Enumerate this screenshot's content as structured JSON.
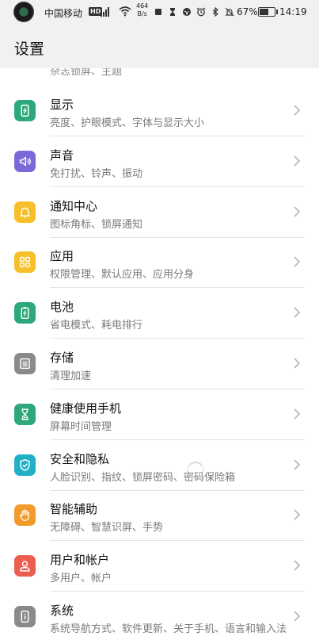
{
  "status_bar": {
    "carrier": "中国移动",
    "hd": "HD",
    "network": "4G",
    "speed_value": "464",
    "speed_unit": "B/s",
    "battery_percent": "67%",
    "battery_level": 0.67,
    "time": "14:19"
  },
  "header": {
    "title": "设置"
  },
  "partial_item": {
    "subtitle": "杂志锁屏、主题",
    "color": "#2ca87a"
  },
  "items": [
    {
      "title": "显示",
      "subtitle": "亮度、护眼模式、字体与显示大小",
      "icon": "display-icon",
      "color": "#2ca87a"
    },
    {
      "title": "声音",
      "subtitle": "免打扰、铃声、振动",
      "icon": "sound-icon",
      "color": "#7b68d9"
    },
    {
      "title": "通知中心",
      "subtitle": "图标角标、锁屏通知",
      "icon": "bell-icon",
      "color": "#f5c02a"
    },
    {
      "title": "应用",
      "subtitle": "权限管理、默认应用、应用分身",
      "icon": "apps-grid-icon",
      "color": "#f5c02a"
    },
    {
      "title": "电池",
      "subtitle": "省电模式、耗电排行",
      "icon": "battery-icon",
      "color": "#2ca87a"
    },
    {
      "title": "存储",
      "subtitle": "清理加速",
      "icon": "storage-icon",
      "color": "#8a8a8a"
    },
    {
      "title": "健康使用手机",
      "subtitle": "屏幕时间管理",
      "icon": "hourglass-icon",
      "color": "#2ca87a"
    },
    {
      "title": "安全和隐私",
      "subtitle": "人脸识别、指纹、锁屏密码、密码保险箱",
      "icon": "shield-icon",
      "color": "#22b0c5"
    },
    {
      "title": "智能辅助",
      "subtitle": "无障碍、智慧识屏、手势",
      "icon": "hand-icon",
      "color": "#f39a2b"
    },
    {
      "title": "用户和帐户",
      "subtitle": "多用户、帐户",
      "icon": "user-icon",
      "color": "#ec5e4f"
    },
    {
      "title": "系统",
      "subtitle": "系统导航方式、软件更新、关于手机、语言和输入法",
      "icon": "phone-info-icon",
      "color": "#8a8a8a"
    }
  ]
}
